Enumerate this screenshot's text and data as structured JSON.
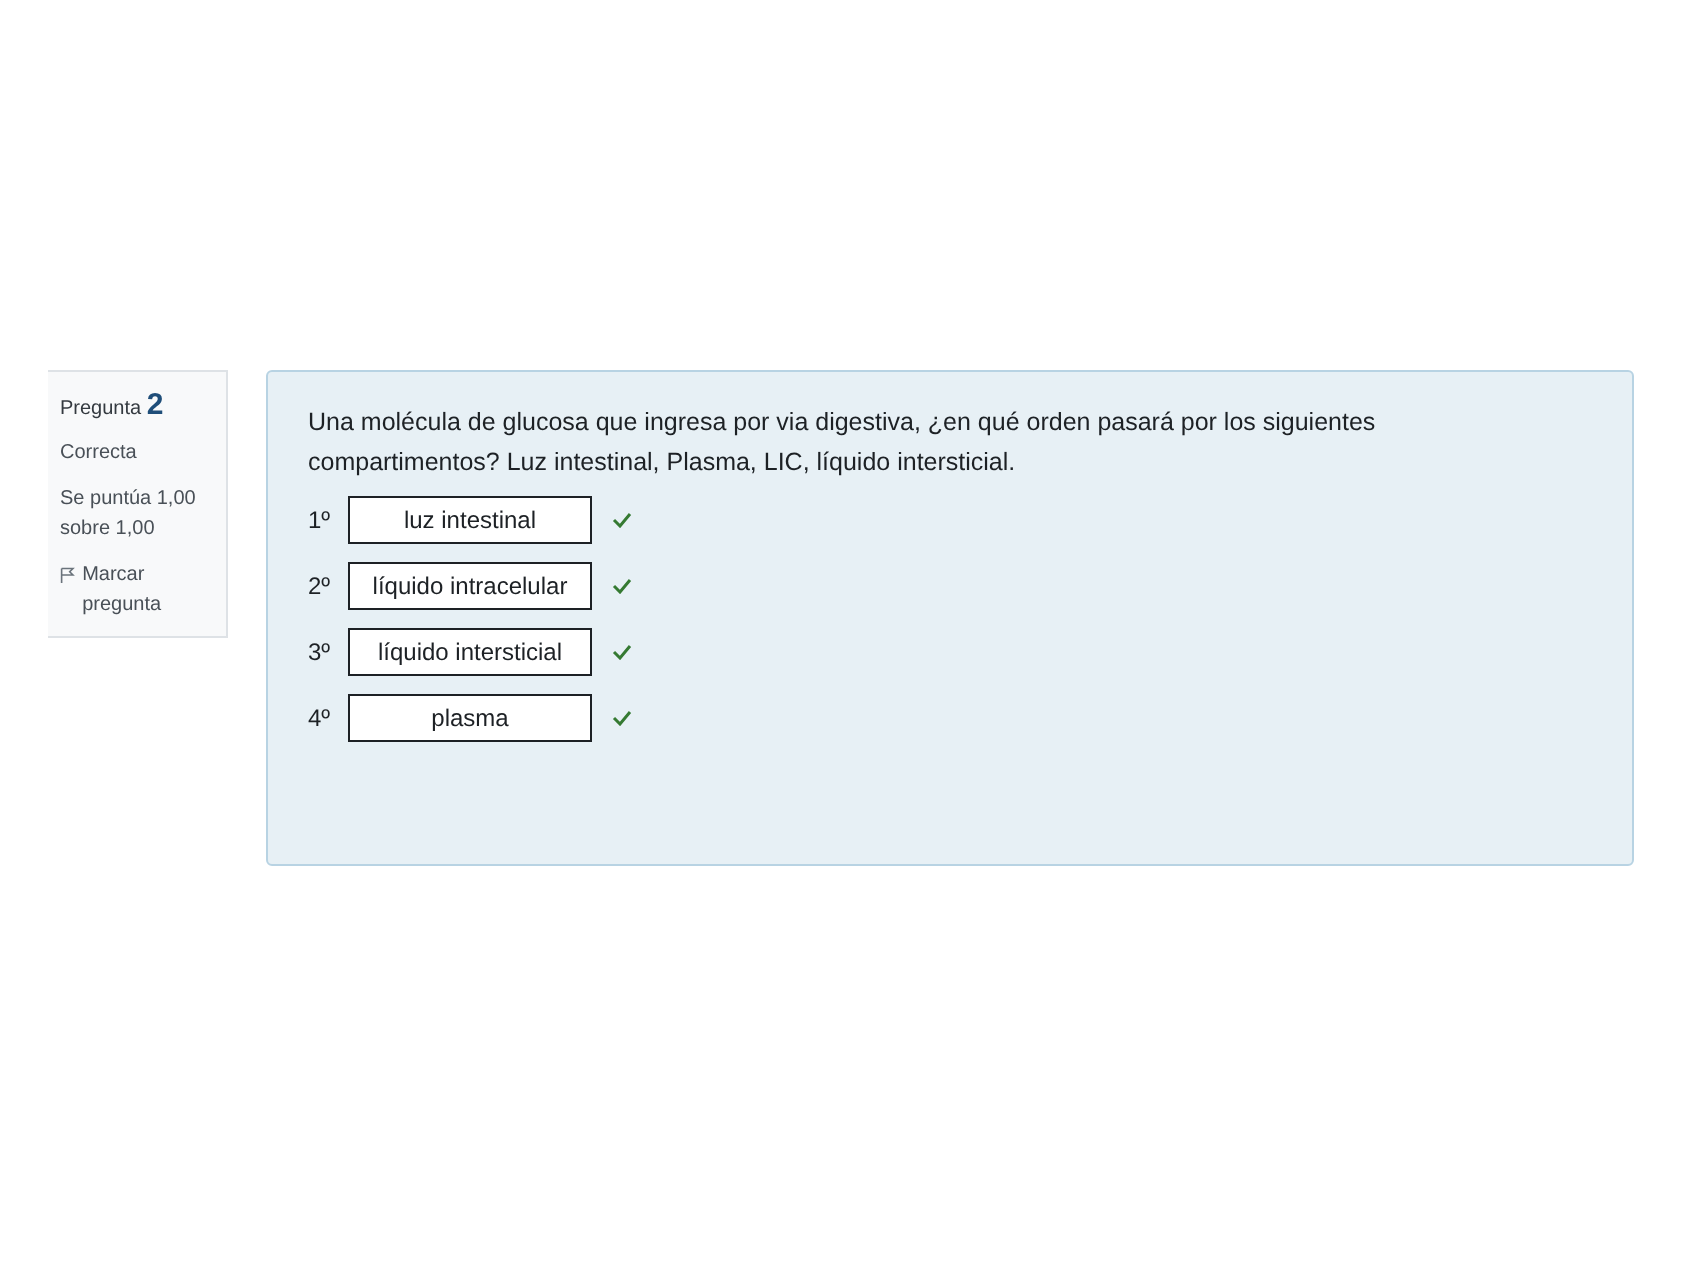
{
  "info": {
    "label": "Pregunta",
    "number": "2",
    "status": "Correcta",
    "score": "Se puntúa 1,00 sobre 1,00",
    "flag": "Marcar pregunta"
  },
  "question": {
    "text": "Una molécula de glucosa que ingresa por via digestiva, ¿en qué orden pasará por los siguientes compartimentos? Luz intestinal, Plasma, LIC, líquido intersticial.",
    "answers": [
      {
        "ordinal": "1º",
        "value": "luz intestinal",
        "correct": true
      },
      {
        "ordinal": "2º",
        "value": "líquido intracelular",
        "correct": true
      },
      {
        "ordinal": "3º",
        "value": "líquido intersticial",
        "correct": true
      },
      {
        "ordinal": "4º",
        "value": "plasma",
        "correct": true
      }
    ]
  }
}
